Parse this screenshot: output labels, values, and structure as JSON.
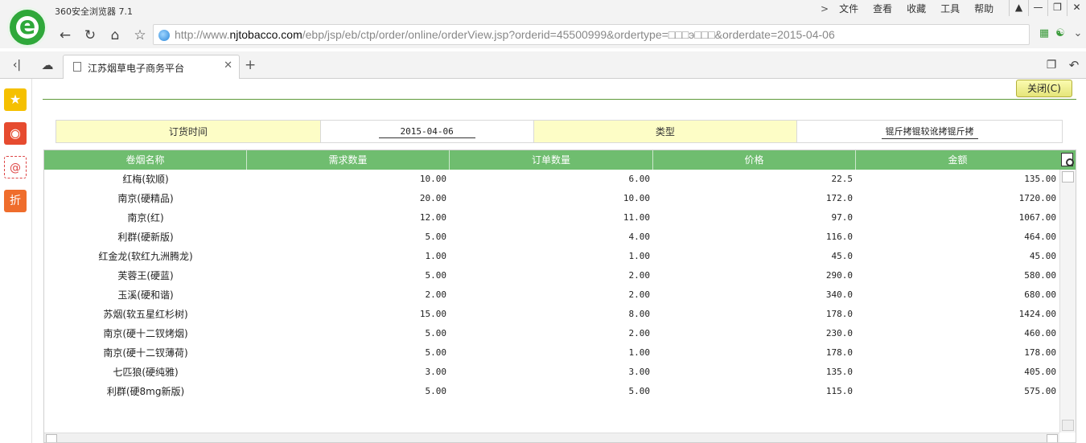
{
  "browser": {
    "app_title": "360安全浏览器 7.1",
    "menu": [
      "文件",
      "查看",
      "收藏",
      "工具",
      "帮助"
    ],
    "window_controls": [
      "pin-icon",
      "minimize-icon",
      "restore-icon",
      "close-icon"
    ],
    "address": {
      "prefix": "http://www.",
      "domain": "njtobacco.com",
      "path": "/ebp/jsp/eb/ctp/order/online/orderView.jsp?orderid=45500999&ordertype=□□□э□□□&orderdate=2015-04-06"
    },
    "tab": {
      "title": "江苏烟草电子商务平台"
    },
    "new_tab_label": "+"
  },
  "sidebar": {
    "items": [
      {
        "icon": "star-icon",
        "color": "#f5c000"
      },
      {
        "icon": "weibo-icon",
        "color": "#e64b2f"
      },
      {
        "icon": "mail-icon",
        "color": "#ffffff"
      },
      {
        "icon": "discount-icon",
        "color": "#ef6d2c",
        "label": "折"
      }
    ]
  },
  "page": {
    "close_button": "关闭(C)",
    "info": {
      "date_label": "订货时间",
      "date_value": "2015-04-06",
      "type_label": "类型",
      "type_value": "锟斤拷锟较讹拷锟斤拷"
    },
    "grid": {
      "columns": [
        "卷烟名称",
        "需求数量",
        "订单数量",
        "价格",
        "金额"
      ],
      "rows": [
        [
          "红梅(软顺)",
          "10.00",
          "6.00",
          "22.5",
          "135.00"
        ],
        [
          "南京(硬精品)",
          "20.00",
          "10.00",
          "172.0",
          "1720.00"
        ],
        [
          "南京(红)",
          "12.00",
          "11.00",
          "97.0",
          "1067.00"
        ],
        [
          "利群(硬新版)",
          "5.00",
          "4.00",
          "116.0",
          "464.00"
        ],
        [
          "红金龙(软红九洲腾龙)",
          "1.00",
          "1.00",
          "45.0",
          "45.00"
        ],
        [
          "芙蓉王(硬蓝)",
          "5.00",
          "2.00",
          "290.0",
          "580.00"
        ],
        [
          "玉溪(硬和谐)",
          "2.00",
          "2.00",
          "340.0",
          "680.00"
        ],
        [
          "苏烟(软五星红杉树)",
          "15.00",
          "8.00",
          "178.0",
          "1424.00"
        ],
        [
          "南京(硬十二钗烤烟)",
          "5.00",
          "2.00",
          "230.0",
          "460.00"
        ],
        [
          "南京(硬十二钗薄荷)",
          "5.00",
          "1.00",
          "178.0",
          "178.00"
        ],
        [
          "七匹狼(硬纯雅)",
          "3.00",
          "3.00",
          "135.0",
          "405.00"
        ],
        [
          "利群(硬8mg新版)",
          "5.00",
          "5.00",
          "115.0",
          "575.00"
        ]
      ]
    }
  },
  "colors": {
    "grid_header": "#6fbd6f",
    "label_cell": "#fdfdc6",
    "brand_green": "#2fa83a"
  }
}
